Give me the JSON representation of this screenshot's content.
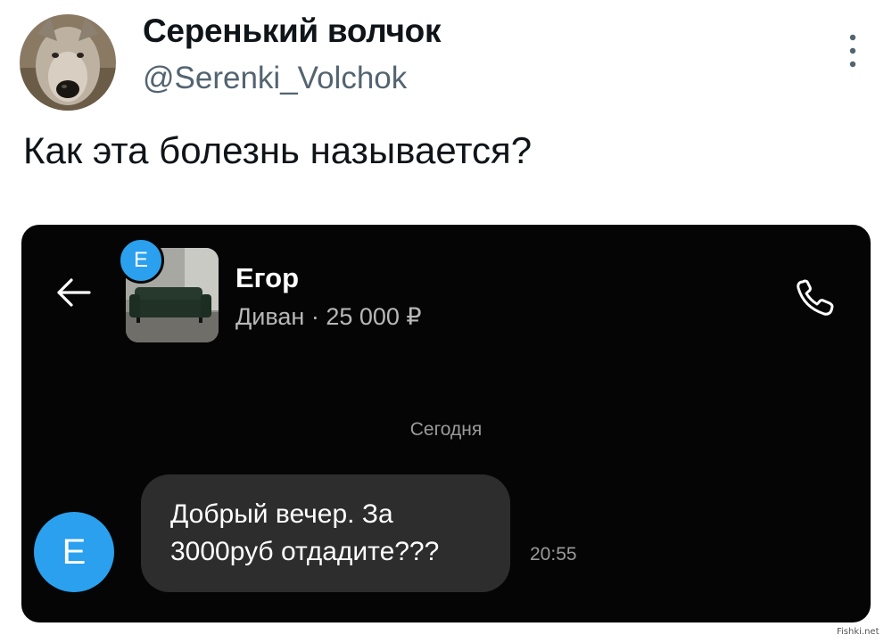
{
  "tweet": {
    "display_name": "Серенький волчок",
    "handle": "@Serenki_Volchok",
    "text": "Как эта болезнь называется?",
    "avatar_icon": "wolf-avatar",
    "more_icon": "more-vertical-icon"
  },
  "chat": {
    "back_icon": "arrow-left-icon",
    "seller_badge_letter": "Е",
    "contact_name": "Егор",
    "listing_info": "Диван · 25 000 ₽",
    "call_icon": "phone-icon",
    "day_separator": "Сегодня",
    "sender_avatar_letter": "Е",
    "message_lines": [
      "Добрый вечер. За",
      "3000руб отдадите???"
    ],
    "message_time": "20:55",
    "colors": {
      "background": "#050505",
      "bubble": "#2d2d2d",
      "accent": "#2aa0ee"
    }
  },
  "watermark": "Fishki.net"
}
